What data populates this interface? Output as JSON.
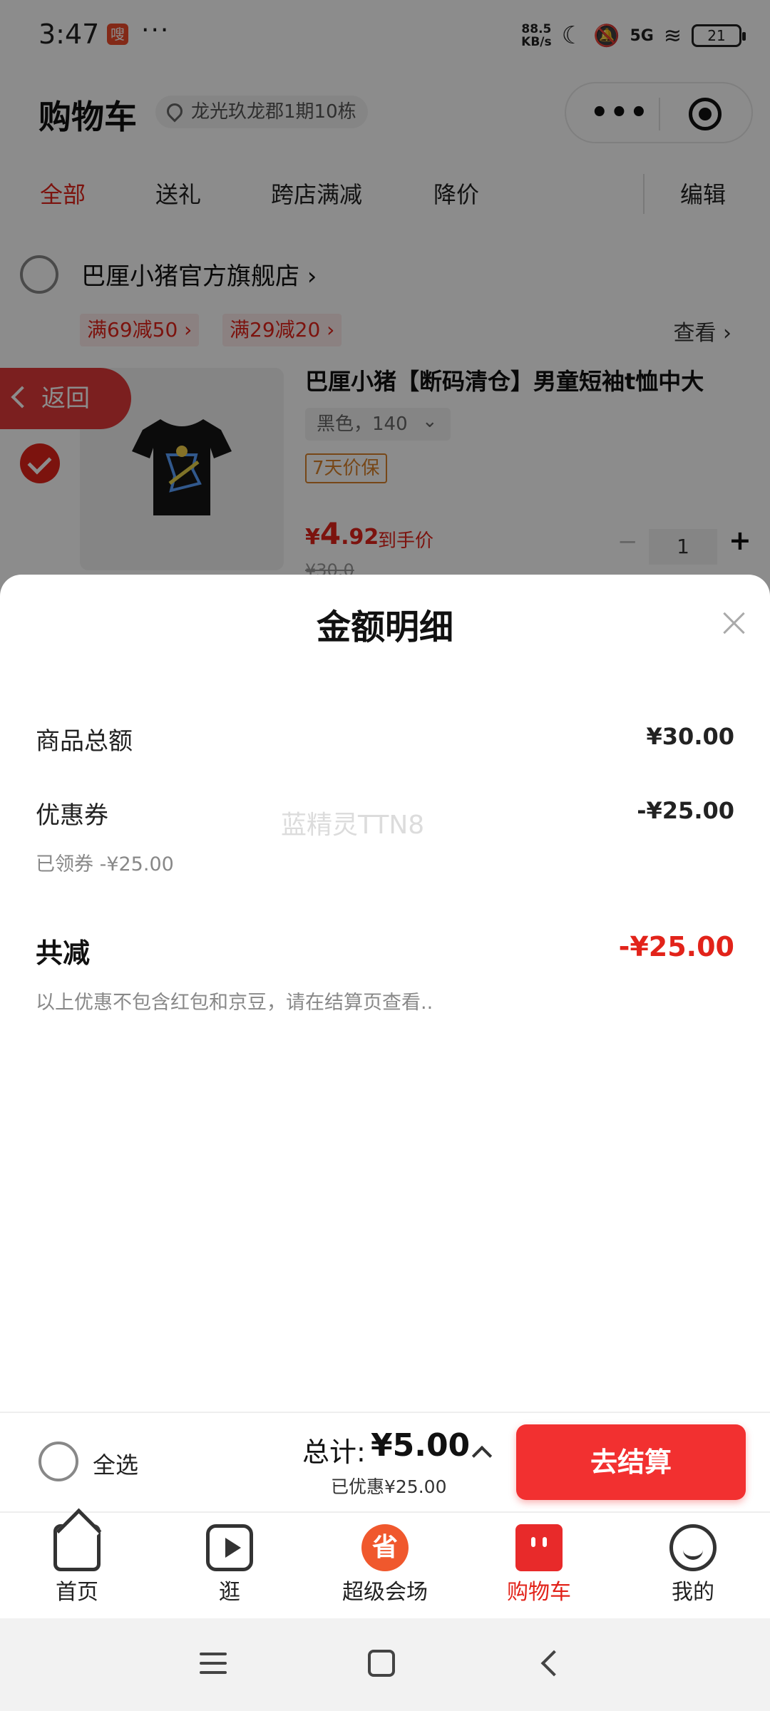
{
  "status_bar": {
    "time": "3:47",
    "app_badge": "嗖",
    "network_speed_value": "88.5",
    "network_speed_unit": "KB/s",
    "network_type": "5G",
    "battery": "21"
  },
  "header": {
    "title": "购物车",
    "address": "龙光玖龙郡1期10栋"
  },
  "tabs": [
    {
      "label": "全部",
      "active": true
    },
    {
      "label": "送礼",
      "active": false
    },
    {
      "label": "跨店满减",
      "active": false
    },
    {
      "label": "降价",
      "active": false
    }
  ],
  "edit_label": "编辑",
  "shop": {
    "name": "巴厘小猪官方旗舰店",
    "promos": [
      "满69减50 ›",
      "满29减20 ›"
    ],
    "view_label": "查看 ›"
  },
  "item": {
    "title": "巴厘小猪【断码清仓】男童短袖t恤中大",
    "spec": "黑色，140",
    "guarantee": "7天价保",
    "price_currency": "¥",
    "price_int": "4",
    "price_dec": ".92",
    "price_label": "到手价",
    "old_price": "¥30.0",
    "quantity": "1"
  },
  "back_button": "返回",
  "sheet": {
    "title": "金额明细",
    "rows": [
      {
        "label": "商品总额",
        "value": "¥30.00"
      },
      {
        "label": "优惠券",
        "value": "-¥25.00"
      }
    ],
    "coupon_sub": "已领券 -¥25.00",
    "total_label": "共减",
    "total_value": "-¥25.00",
    "note": "以上优惠不包含红包和京豆，请在结算页查看..",
    "watermark": "蓝精灵TTN8"
  },
  "checkout": {
    "select_all": "全选",
    "total_label": "总计:",
    "total_value": "¥5.00",
    "saved": "已优惠¥25.00",
    "button": "去结算"
  },
  "tabbar": [
    {
      "label": "首页",
      "icon": "home-icon"
    },
    {
      "label": "逛",
      "icon": "play-icon"
    },
    {
      "label": "超级会场",
      "icon": "super-venue-icon",
      "glyph": "省"
    },
    {
      "label": "购物车",
      "icon": "cart-icon",
      "active": true
    },
    {
      "label": "我的",
      "icon": "profile-icon"
    }
  ],
  "colors": {
    "accent": "#e2231a",
    "checkout_button": "#f23030"
  }
}
